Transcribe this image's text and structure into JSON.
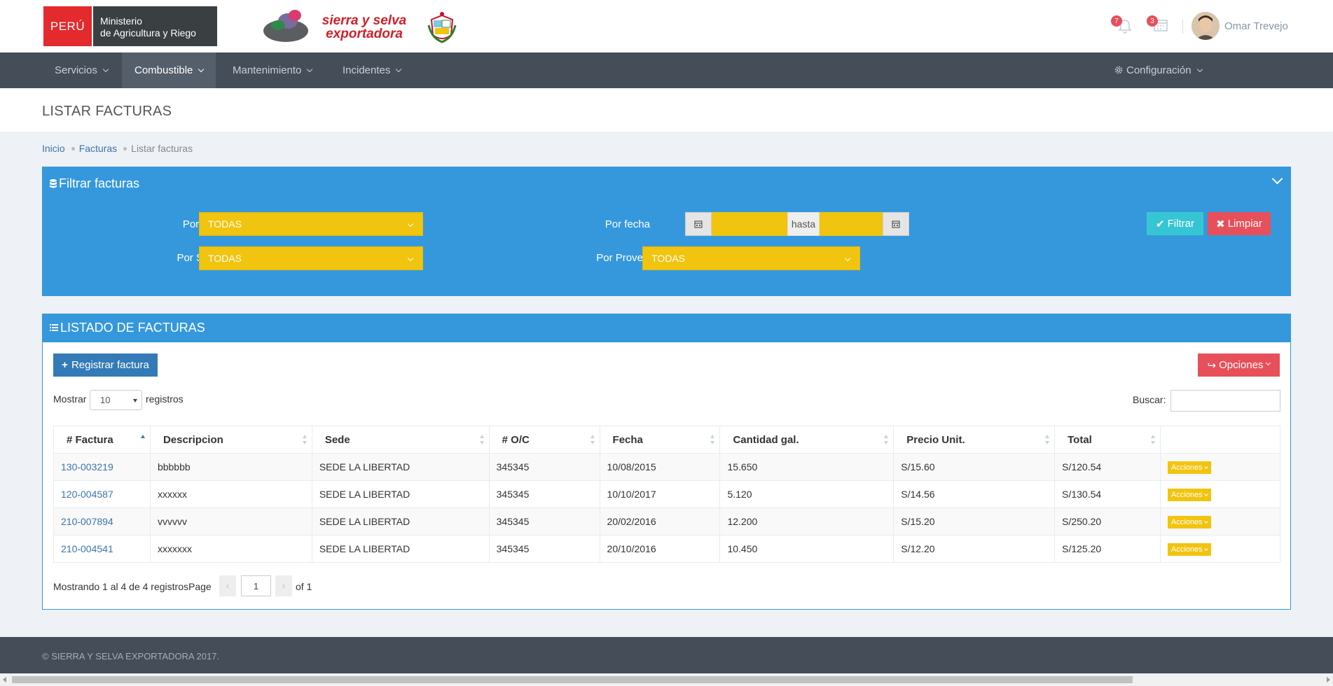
{
  "header": {
    "logo_peru": "PERÚ",
    "logo_ministerio_1": "Ministerio",
    "logo_ministerio_2": "de Agricultura y Riego",
    "brand_line1": "sierra y selva",
    "brand_line2": "exportadora",
    "notifications_count": "7",
    "calendar_count": "3",
    "user_name": "Omar Trevejo"
  },
  "nav": {
    "items": [
      {
        "label": "Servicios"
      },
      {
        "label": "Combustible"
      },
      {
        "label": "Mantenimiento"
      },
      {
        "label": "Incidentes"
      }
    ],
    "config_label": "Configuración"
  },
  "page": {
    "title": "LISTAR FACTURAS",
    "breadcrumb": [
      "Inicio",
      "Facturas",
      "Listar facturas"
    ]
  },
  "filter": {
    "title": "Filtrar facturas",
    "oc_label": "Por O/C",
    "oc_value": "TODAS",
    "sede_label": "Por Sede",
    "sede_value": "TODAS",
    "fecha_label": "Por fecha",
    "hasta": "hasta",
    "proveedor_label": "Por Proveedor",
    "proveedor_value": "TODAS",
    "filtrar_label": "Filtrar",
    "limpiar_label": "Limpiar"
  },
  "list": {
    "title": "LISTADO DE FACTURAS",
    "register_label": "Registrar factura",
    "options_label": "Opciones",
    "show_label": "Mostrar",
    "page_length": "10",
    "records_label": "registros",
    "search_label": "Buscar:",
    "columns": [
      "# Factura",
      "Descripcion",
      "Sede",
      "# O/C",
      "Fecha",
      "Cantidad gal.",
      "Precio Unit.",
      "Total",
      ""
    ],
    "actions_label": "Acciones",
    "rows": [
      {
        "factura": "130-003219",
        "descripcion": "bbbbbb",
        "sede": "SEDE LA LIBERTAD",
        "oc": "345345",
        "fecha": "10/08/2015",
        "cantidad": "15.650",
        "precio": "S/15.60",
        "total": "S/120.54"
      },
      {
        "factura": "120-004587",
        "descripcion": "xxxxxx",
        "sede": "SEDE LA LIBERTAD",
        "oc": "345345",
        "fecha": "10/10/2017",
        "cantidad": "5.120",
        "precio": "S/14.56",
        "total": "S/130.54"
      },
      {
        "factura": "210-007894",
        "descripcion": "vvvvvv",
        "sede": "SEDE LA LIBERTAD",
        "oc": "345345",
        "fecha": "20/02/2016",
        "cantidad": "12.200",
        "precio": "S/15.20",
        "total": "S/250.20"
      },
      {
        "factura": "210-004541",
        "descripcion": "xxxxxxx",
        "sede": "SEDE LA LIBERTAD",
        "oc": "345345",
        "fecha": "20/10/2016",
        "cantidad": "10.450",
        "precio": "S/12.20",
        "total": "S/125.20"
      }
    ],
    "info": "Mostrando 1 al 4 de 4 registros",
    "page_label": "Page",
    "page_value": "1",
    "of_label": "of 1"
  },
  "footer": {
    "text": "© SIERRA Y SELVA EXPORTADORA 2017."
  },
  "colors": {
    "nav_bg": "#444d58",
    "portlet_blue": "#3598dc",
    "select_yellow": "#f1c40f",
    "danger": "#e7505a",
    "info": "#36c6d3",
    "primary": "#337ab7"
  }
}
